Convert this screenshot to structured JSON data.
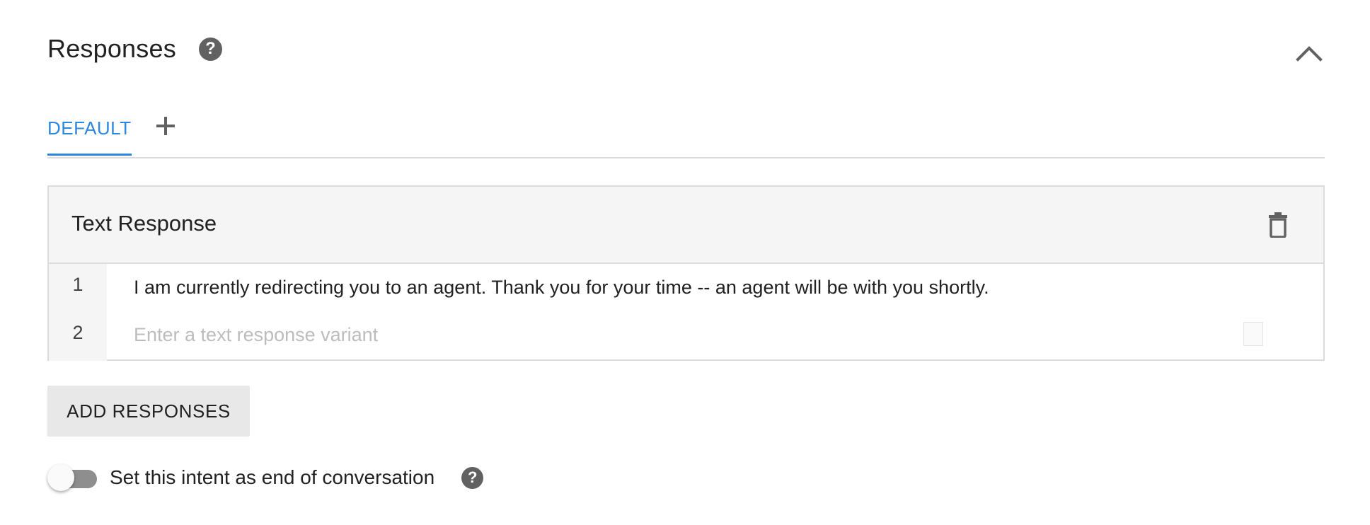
{
  "section": {
    "title": "Responses",
    "help_icon": "help-circle-icon",
    "collapse_icon": "chevron-up-icon"
  },
  "tabs": {
    "items": [
      {
        "label": "DEFAULT",
        "active": true
      }
    ],
    "add_icon": "plus-icon"
  },
  "text_response": {
    "title": "Text Response",
    "delete_icon": "trash-icon",
    "rows": [
      {
        "number": "1",
        "text": "I am currently redirecting you to an agent. Thank you for your time -- an agent will be with you shortly."
      },
      {
        "number": "2",
        "value": "",
        "placeholder": "Enter a text response variant"
      }
    ]
  },
  "add_responses": {
    "label": "ADD RESPONSES"
  },
  "end_conversation": {
    "label": "Set this intent as end of conversation",
    "enabled": false,
    "help_icon": "help-circle-icon"
  },
  "colors": {
    "accent": "#2c88de",
    "icon_gray": "#616161",
    "header_bg": "#f5f5f5",
    "border": "#dcdcdc",
    "button_bg": "#e8e8e8",
    "placeholder": "#bdbdbd"
  }
}
